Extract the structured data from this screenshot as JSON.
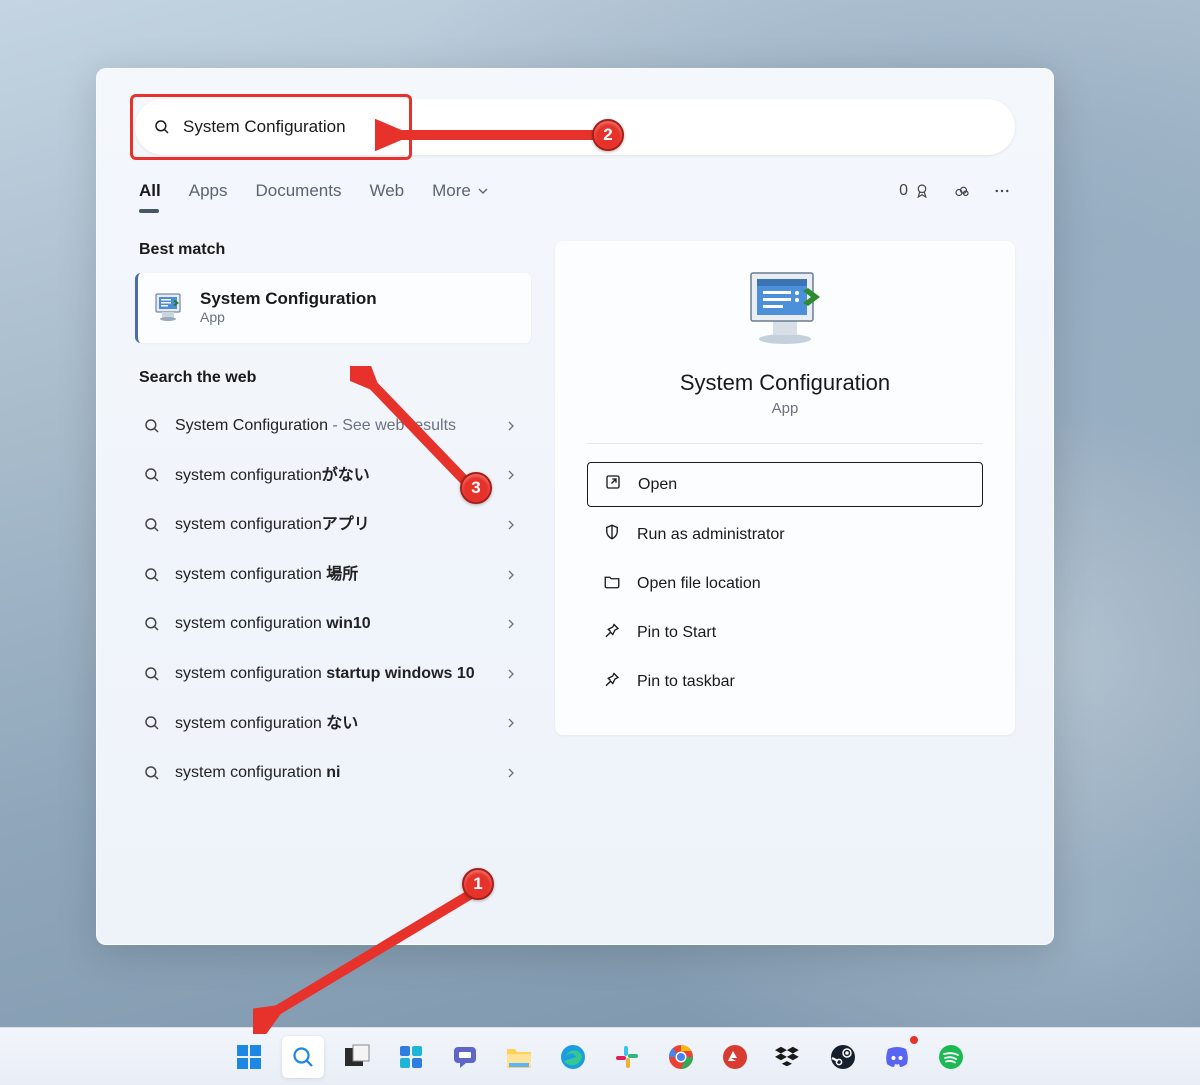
{
  "search": {
    "value": "System Configuration"
  },
  "filters": {
    "items": [
      "All",
      "Apps",
      "Documents",
      "Web",
      "More"
    ],
    "active": 0,
    "reward_count": "0"
  },
  "sections": {
    "best_match": "Best match",
    "search_web": "Search the web"
  },
  "best": {
    "title": "System Configuration",
    "subtitle": "App"
  },
  "web_results": [
    {
      "prefix": "System Configuration",
      "suffix": "",
      "extra": " - See web results"
    },
    {
      "prefix": "system configuration",
      "suffix": "がない",
      "extra": ""
    },
    {
      "prefix": "system configuration",
      "suffix": "アプリ",
      "extra": ""
    },
    {
      "prefix": "system configuration ",
      "suffix": "場所",
      "extra": ""
    },
    {
      "prefix": "system configuration ",
      "suffix": "win10",
      "extra": ""
    },
    {
      "prefix": "system configuration ",
      "suffix": "startup windows 10",
      "extra": ""
    },
    {
      "prefix": "system configuration ",
      "suffix": "ない",
      "extra": ""
    },
    {
      "prefix": "system configuration ",
      "suffix": "ni",
      "extra": ""
    }
  ],
  "detail": {
    "title": "System Configuration",
    "subtitle": "App",
    "actions": [
      {
        "icon": "open",
        "label": "Open",
        "primary": true
      },
      {
        "icon": "shield",
        "label": "Run as administrator"
      },
      {
        "icon": "folder",
        "label": "Open file location"
      },
      {
        "icon": "pin",
        "label": "Pin to Start"
      },
      {
        "icon": "pin",
        "label": "Pin to taskbar"
      }
    ]
  },
  "taskbar": [
    "start",
    "search",
    "taskview",
    "widgets",
    "teams",
    "explorer",
    "edge",
    "slack",
    "chrome",
    "expressvpn",
    "dropbox",
    "steam",
    "discord",
    "spotify"
  ],
  "annotations": {
    "1": "1",
    "2": "2",
    "3": "3"
  }
}
